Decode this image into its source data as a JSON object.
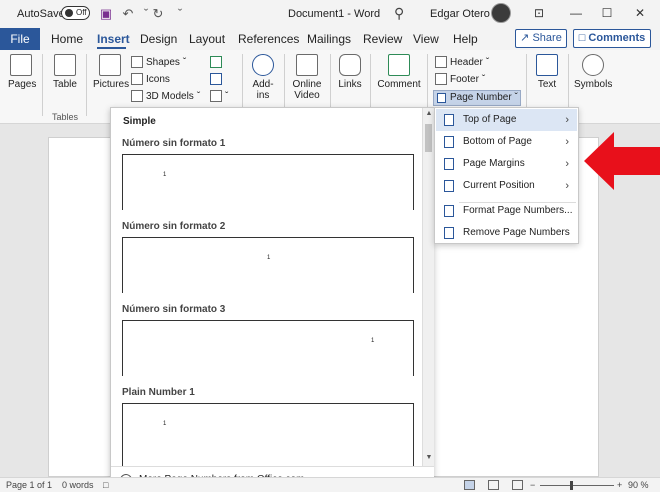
{
  "titlebar": {
    "autosave_label": "AutoSave",
    "autosave_state": "Off",
    "document_title": "Document1 - Word",
    "user_name": "Edgar Otero",
    "qa_icons": [
      "save-icon",
      "undo-icon",
      "redo-icon",
      "customize-icon"
    ],
    "window_icons": [
      "ribbon-display-icon",
      "minimize-icon",
      "maximize-icon",
      "close-icon"
    ],
    "window_glyphs": [
      "⊡",
      "—",
      "☐",
      "✕"
    ]
  },
  "tabs": {
    "file": "File",
    "items": [
      "Home",
      "Insert",
      "Design",
      "Layout",
      "References",
      "Mailings",
      "Review",
      "View",
      "Help"
    ],
    "active": "Insert",
    "share": "Share",
    "comments": "Comments"
  },
  "ribbon": {
    "pages": "Pages",
    "table": "Table",
    "pictures": "Pictures",
    "shapes": "Shapes",
    "icons": "Icons",
    "models3d": "3D Models",
    "addins": "Add-ins",
    "online_video_line1": "Online",
    "online_video_line2": "Video",
    "links": "Links",
    "comment": "Comment",
    "header": "Header",
    "footer": "Footer",
    "page_number": "Page Number",
    "text": "Text",
    "symbols": "Symbols",
    "tables_group": "Tables"
  },
  "gallery": {
    "section": "Simple",
    "items": [
      {
        "label": "Número sin formato 1",
        "num": "1",
        "align": "left"
      },
      {
        "label": "Número sin formato 2",
        "num": "1",
        "align": "center"
      },
      {
        "label": "Número sin formato 3",
        "num": "1",
        "align": "right"
      },
      {
        "label": "Plain Number 1",
        "num": "1",
        "align": "left"
      }
    ],
    "footer_link": "More Page Numbers from Office.com"
  },
  "submenu": {
    "items": [
      {
        "label": "Top of Page",
        "has_submenu": true,
        "highlighted": true
      },
      {
        "label": "Bottom of Page",
        "has_submenu": true,
        "highlighted": false
      },
      {
        "label": "Page Margins",
        "has_submenu": true,
        "highlighted": false
      },
      {
        "label": "Current Position",
        "has_submenu": true,
        "highlighted": false
      },
      {
        "label": "Format Page Numbers...",
        "has_submenu": false,
        "highlighted": false
      },
      {
        "label": "Remove Page Numbers",
        "has_submenu": false,
        "highlighted": false
      }
    ]
  },
  "statusbar": {
    "page": "Page 1 of 1",
    "words": "0 words",
    "zoom": "90 %"
  },
  "colors": {
    "accent": "#2b579a",
    "arrow": "#e8101b"
  }
}
